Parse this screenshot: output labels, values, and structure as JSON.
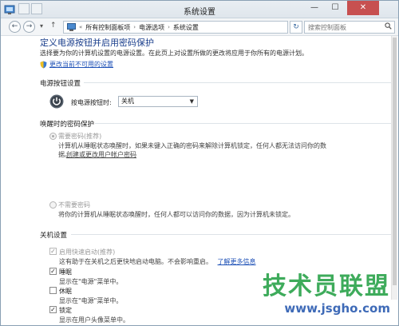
{
  "window": {
    "title": "系统设置",
    "min": "—",
    "max": "☐",
    "close": "✕"
  },
  "nav": {
    "back": "←",
    "forward": "→",
    "dropdown": "▾",
    "up": "↑",
    "overflow": "«",
    "breadcrumb": [
      "所有控制面板项",
      "电源选项",
      "系统设置"
    ],
    "refresh": "↻",
    "search_placeholder": "搜索控制面板"
  },
  "page": {
    "heading": "定义电源按钮并启用密码保护",
    "description": "选择要为你的计算机设置的电源设置。在此页上对设置所做的更改将应用于你所有的电源计划。",
    "change_unavailable_link": "更改当前不可用的设置"
  },
  "power_button_section": {
    "title": "电源按钮设置",
    "label": "按电源按钮时:",
    "selected": "关机"
  },
  "wake_password_section": {
    "title": "唤醒时的密码保护",
    "require": {
      "label": "需要密码(推荐)",
      "desc_line1": "计算机从睡眠状态唤醒时，如果未键入正确的密码来解除计算机锁定，任何人都无法访问你的数",
      "desc_line2": "据。",
      "link": "创建或更改用户帐户密码"
    },
    "not_require": {
      "label": "不需要密码",
      "desc": "将你的计算机从睡眠状态唤醒时，任何人都可以访问你的数据，因为计算机未锁定。"
    }
  },
  "shutdown_section": {
    "title": "关机设置",
    "items": [
      {
        "label": "启用快速启动(推荐)",
        "desc": "这有助于在关机之后更快地启动电脑。不会影响重启。",
        "link": "了解更多信息",
        "checked": true
      },
      {
        "label": "睡眠",
        "desc": "显示在\"电源\"菜单中。",
        "checked": true
      },
      {
        "label": "休眠",
        "desc": "显示在\"电源\"菜单中。",
        "checked": false
      },
      {
        "label": "锁定",
        "desc": "显示在用户头像菜单中。",
        "checked": true
      }
    ]
  },
  "watermark": {
    "cn": "技术员联盟",
    "url": "www.jsgho.com"
  }
}
